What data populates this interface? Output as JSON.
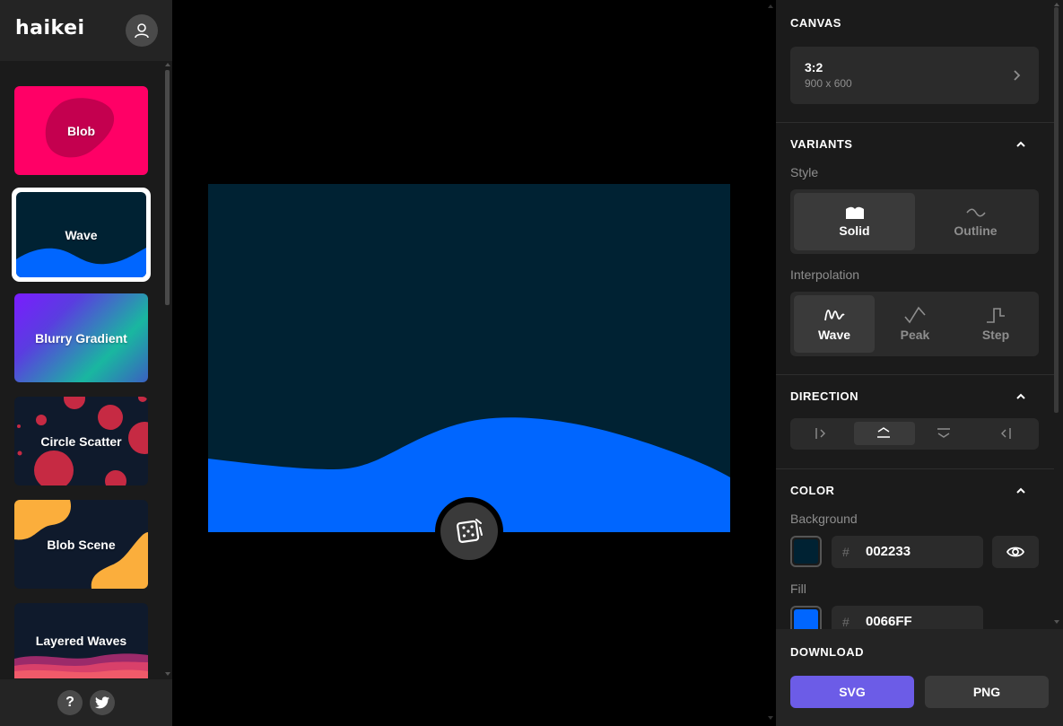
{
  "app": {
    "logo": "haikei"
  },
  "sidebar": {
    "generators": [
      {
        "label": "Blob"
      },
      {
        "label": "Wave"
      },
      {
        "label": "Blurry Gradient"
      },
      {
        "label": "Circle Scatter"
      },
      {
        "label": "Blob Scene"
      },
      {
        "label": "Layered Waves"
      }
    ],
    "footer": {
      "help_label": "?"
    }
  },
  "canvas": {
    "background": "#002233",
    "fill": "#0066FF"
  },
  "panel": {
    "canvas": {
      "title": "CANVAS",
      "ratio": "3:2",
      "size": "900 x 600"
    },
    "variants": {
      "title": "VARIANTS",
      "style_label": "Style",
      "style_options": [
        "Solid",
        "Outline"
      ],
      "interpolation_label": "Interpolation",
      "interpolation_options": [
        "Wave",
        "Peak",
        "Step"
      ]
    },
    "direction": {
      "title": "DIRECTION"
    },
    "color": {
      "title": "COLOR",
      "background_label": "Background",
      "background_hash": "#",
      "background_value": "002233",
      "fill_label": "Fill",
      "fill_hash": "#",
      "fill_value": "0066FF"
    },
    "download": {
      "title": "DOWNLOAD",
      "svg_label": "SVG",
      "png_label": "PNG"
    }
  },
  "colors": {
    "accent": "#6c5ce7",
    "blob_card": "#ff0066",
    "wave_card_bg": "#002233",
    "wave_fill": "#0066ff",
    "blob_scene_accent": "#fbae3c"
  }
}
